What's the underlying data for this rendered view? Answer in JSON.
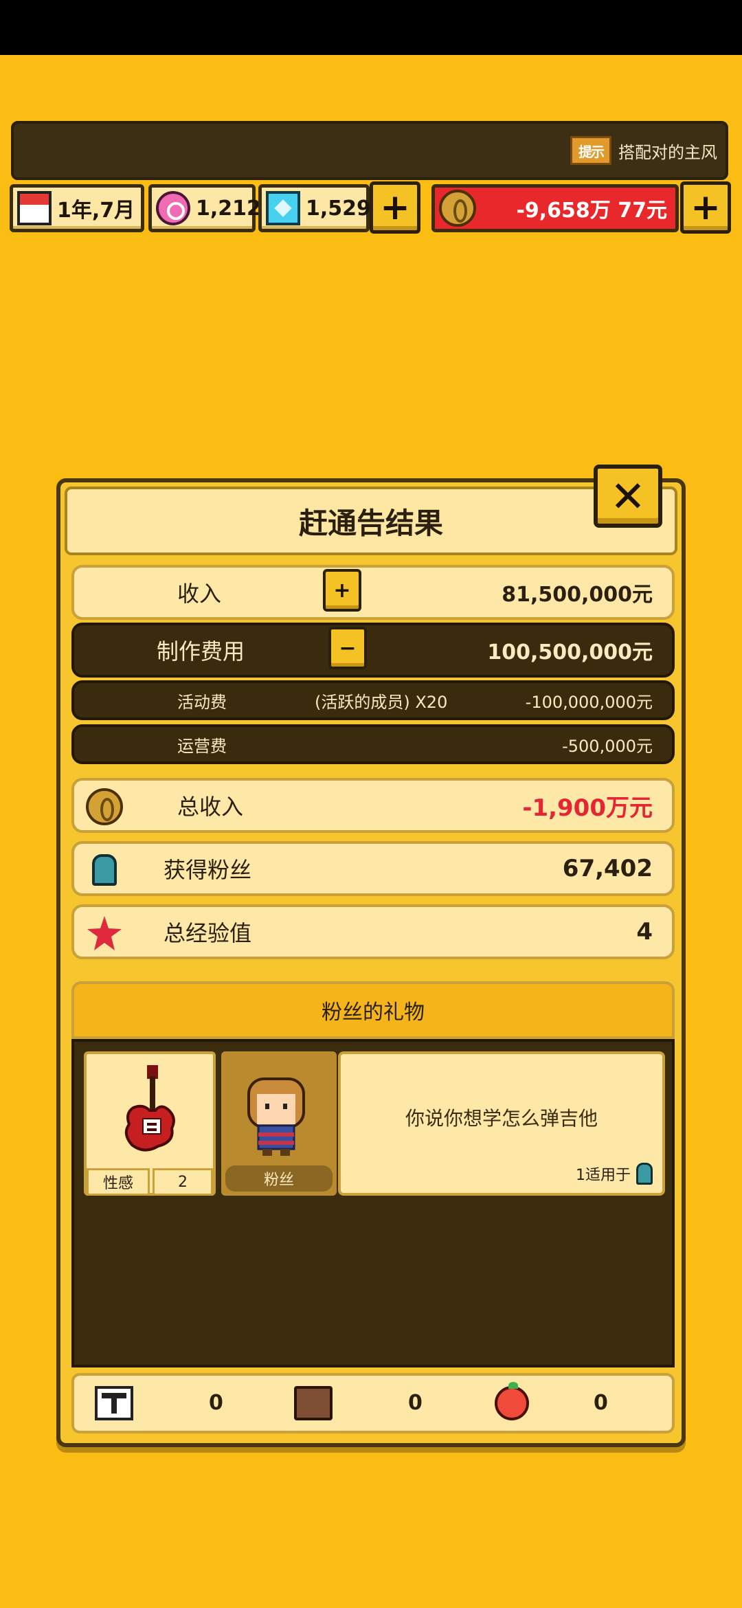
{
  "hud": {
    "tip_badge": "提示",
    "tip_text": "搭配对的主风",
    "date": "1年,7月",
    "pink_currency": "1,212",
    "diamond_currency": "1,529",
    "money": "-9,658万 77元",
    "plus": "+"
  },
  "dialog": {
    "title": "赶通告结果",
    "close": "✕",
    "income_label": "收入",
    "income_sign": "+",
    "income_value": "81,500,000元",
    "cost_label": "制作费用",
    "cost_sign": "−",
    "cost_value": "100,500,000元",
    "activity_label": "活动费",
    "activity_mid": "(活跃的成员) X20",
    "activity_value": "-100,000,000元",
    "ops_label": "运营费",
    "ops_value": "-500,000元",
    "total_label": "总收入",
    "total_value": "-1,900万元",
    "fans_label": "获得粉丝",
    "fans_value": "67,402",
    "exp_label": "总经验值",
    "exp_value": "4"
  },
  "gift": {
    "title": "粉丝的礼物",
    "item_attr": "性感",
    "item_attr_value": "2",
    "giver": "粉丝",
    "message": "你说你想学怎么弹吉他",
    "applies": "1适用于"
  },
  "bottom": {
    "pole_count": "0",
    "bag_count": "0",
    "apple_count": "0"
  },
  "colors": {
    "background": "#fbbd14",
    "negative": "#e42634",
    "money_bar": "#e8282a"
  }
}
